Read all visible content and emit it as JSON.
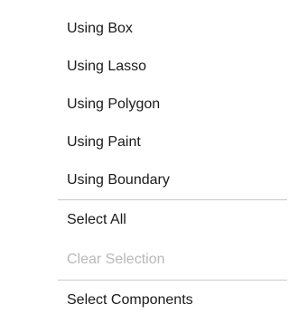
{
  "menu": {
    "items": [
      {
        "label": "Using Box",
        "enabled": true
      },
      {
        "label": "Using Lasso",
        "enabled": true
      },
      {
        "label": "Using Polygon",
        "enabled": true
      },
      {
        "label": "Using Paint",
        "enabled": true
      },
      {
        "label": "Using Boundary",
        "enabled": true
      },
      {
        "label": "Select All",
        "enabled": true
      },
      {
        "label": "Clear Selection",
        "enabled": false
      },
      {
        "label": "Select Components",
        "enabled": true
      }
    ]
  }
}
